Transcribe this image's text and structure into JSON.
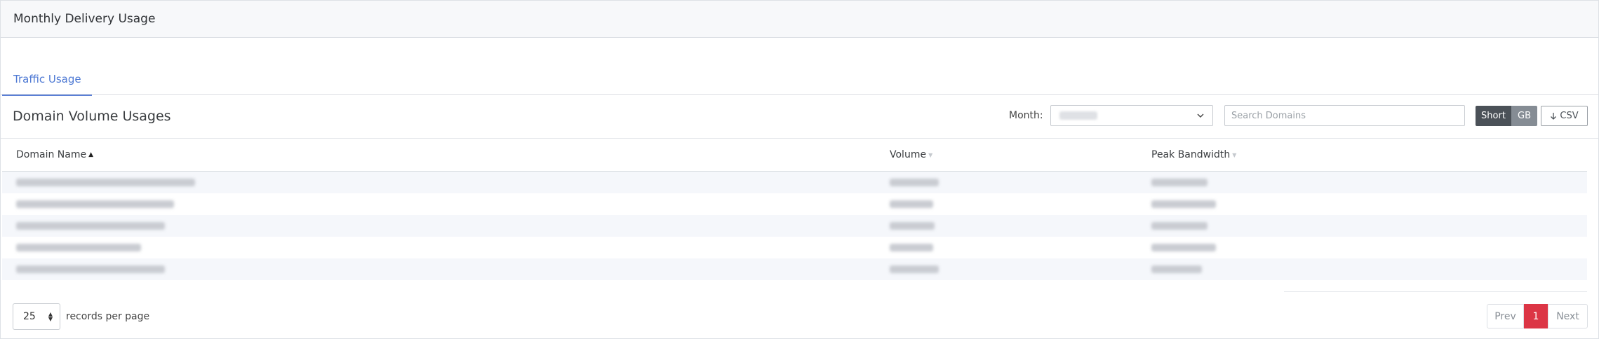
{
  "header": {
    "title": "Monthly Delivery Usage"
  },
  "tabs": [
    {
      "label": "Traffic Usage",
      "active": true
    }
  ],
  "section": {
    "title": "Domain Volume Usages"
  },
  "filters": {
    "month_label": "Month:",
    "month_value": "████",
    "search_placeholder": "Search Domains"
  },
  "units_toggle": {
    "short_label": "Short",
    "gb_label": "GB",
    "active": "Short"
  },
  "csv_button": {
    "label": "CSV",
    "icon": "download-arrow-icon"
  },
  "table": {
    "columns": [
      {
        "label": "Domain Name",
        "sort": "asc"
      },
      {
        "label": "Volume",
        "sort": "none"
      },
      {
        "label": "Peak Bandwidth",
        "sort": "none"
      }
    ],
    "rows": [
      {
        "domain": "█████████████████████████",
        "volume": "██████",
        "bandwidth": "███████"
      },
      {
        "domain": "█████████████████████████",
        "volume": "██████",
        "bandwidth": "███████"
      },
      {
        "domain": "█████████████████████████",
        "volume": "██████",
        "bandwidth": "███████"
      },
      {
        "domain": "█████████████████████████",
        "volume": "██████",
        "bandwidth": "███████"
      },
      {
        "domain": "█████████████████████████",
        "volume": "██████",
        "bandwidth": "███████"
      }
    ]
  },
  "pagination": {
    "per_page_value": "25",
    "per_page_label": "records per page",
    "prev_label": "Prev",
    "current_page": "1",
    "next_label": "Next"
  },
  "colors": {
    "accent": "#4f7ad4",
    "active_page": "#dc3545",
    "toggle_dark": "#4b5158",
    "toggle_light": "#858c94"
  }
}
